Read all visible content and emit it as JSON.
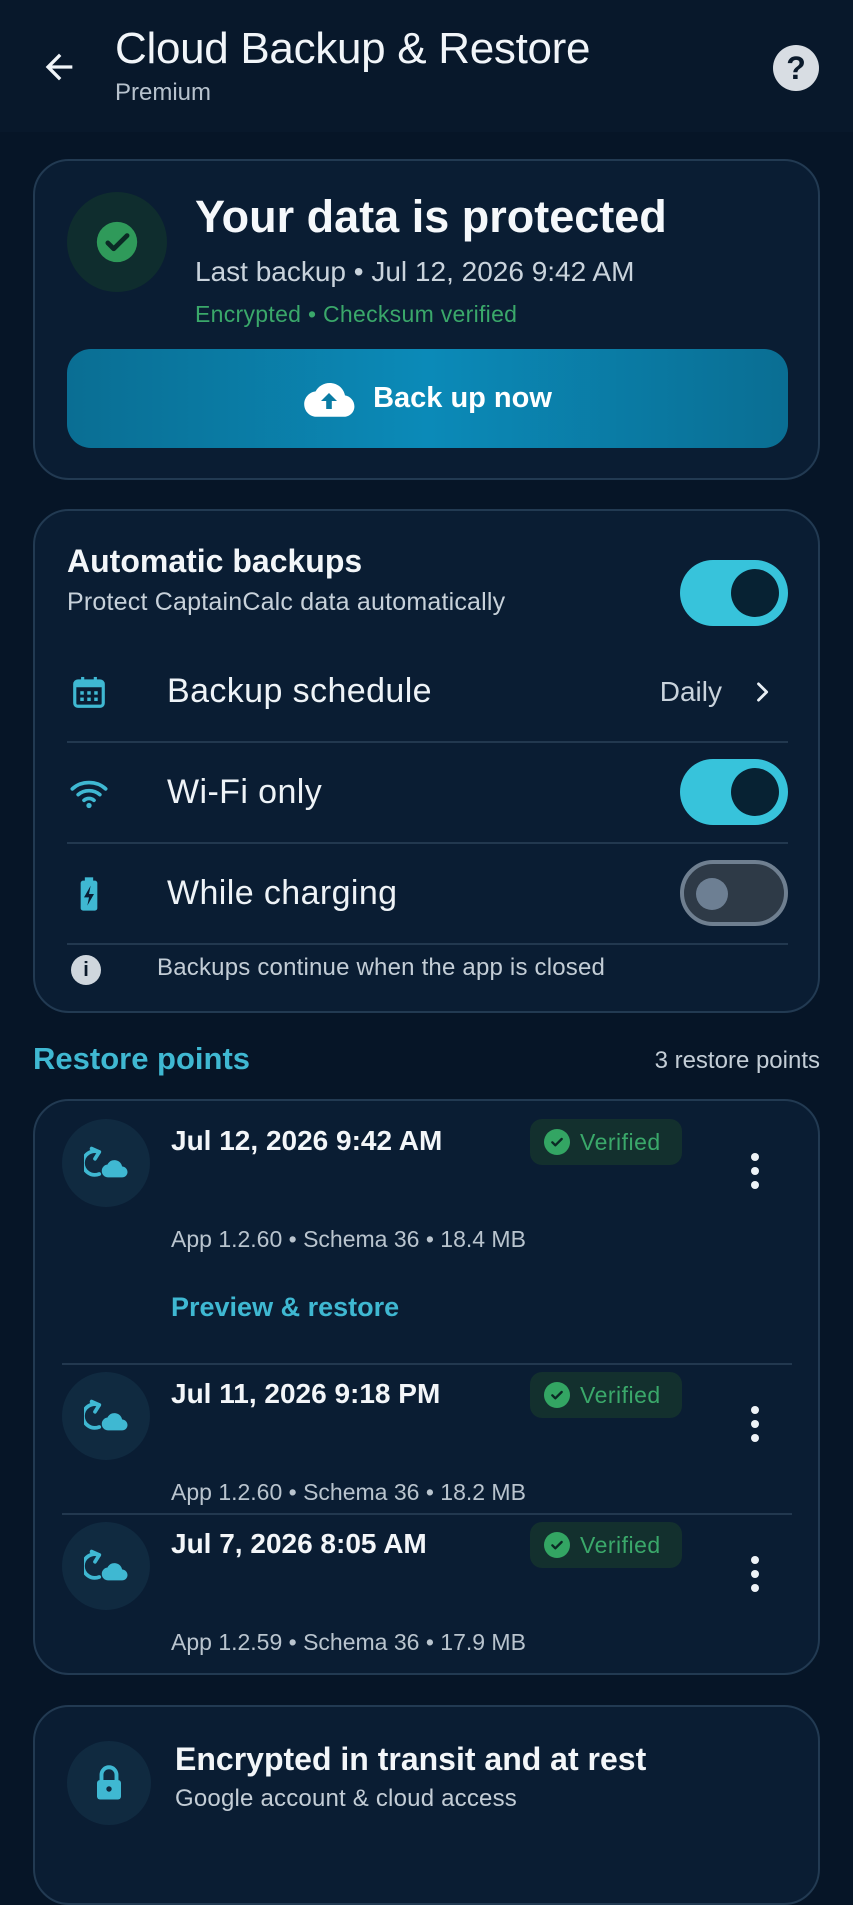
{
  "header": {
    "title": "Cloud Backup & Restore",
    "subtitle": "Premium",
    "help_glyph": "?"
  },
  "status": {
    "title": "Your data is protected",
    "last_backup": "Last backup • Jul 12, 2026 9:42 AM",
    "security": "Encrypted • Checksum verified",
    "backup_button": "Back up now"
  },
  "auto": {
    "title": "Automatic backups",
    "subtitle": "Protect CaptainCalc data automatically",
    "enabled": true,
    "schedule_label": "Backup schedule",
    "schedule_value": "Daily",
    "wifi_label": "Wi-Fi only",
    "wifi_on": true,
    "charging_label": "While charging",
    "charging_on": false,
    "note": "Backups continue when the app is closed",
    "info_glyph": "i"
  },
  "restore": {
    "heading": "Restore points",
    "count": "3 restore points",
    "items": [
      {
        "date": "Jul 12, 2026 9:42 AM",
        "badge": "Verified",
        "meta": "App 1.2.60 • Schema 36 • 18.4 MB",
        "action": "Preview & restore"
      },
      {
        "date": "Jul 11, 2026 9:18 PM",
        "badge": "Verified",
        "meta": "App 1.2.60 • Schema 36 • 18.2 MB"
      },
      {
        "date": "Jul 7, 2026 8:05 AM",
        "badge": "Verified",
        "meta": "App 1.2.59 • Schema 36 • 17.9 MB"
      }
    ]
  },
  "encryption": {
    "title": "Encrypted in transit and at rest",
    "subtitle": "Google account & cloud access"
  },
  "colors": {
    "background": "#061527",
    "accent": "#37c3db",
    "success": "#3aa86a",
    "button": "#0b8ab8"
  },
  "icons": [
    "arrow-back-icon",
    "help-icon",
    "check-icon",
    "cloud-upload-icon",
    "calendar-icon",
    "wifi-icon",
    "battery-charging-icon",
    "chevron-right-icon",
    "info-icon",
    "cloud-restore-icon",
    "more-vert-icon",
    "lock-icon"
  ]
}
